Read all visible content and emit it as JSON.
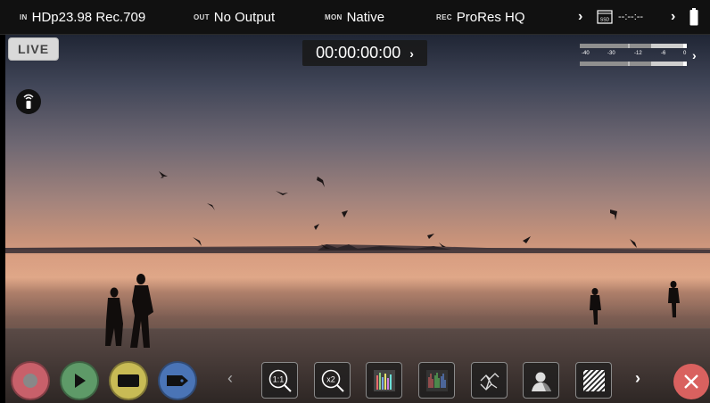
{
  "status_bar": {
    "input": {
      "tag": "IN",
      "value": "HDp23.98 Rec.709"
    },
    "output": {
      "tag": "OUT",
      "value": "No Output"
    },
    "monitor": {
      "tag": "MON",
      "value": "Native"
    },
    "record": {
      "tag": "REC",
      "value": "ProRes HQ"
    },
    "drive_label": "SSD",
    "drive_time": "--:--:--",
    "icons": [
      "chevron-right-icon",
      "ssd-icon",
      "battery-icon"
    ]
  },
  "overlay": {
    "live_label": "LIVE",
    "timecode": "00:00:00:00",
    "meter_scale": [
      "-40",
      "-30",
      "-12",
      "-6",
      "0"
    ],
    "remote_icon": "remote-icon"
  },
  "toolbar": {
    "buttons": [
      {
        "name": "record-button",
        "icon": "record-icon"
      },
      {
        "name": "play-button",
        "icon": "play-icon"
      },
      {
        "name": "display-button",
        "icon": "screen-icon"
      },
      {
        "name": "tag-button",
        "icon": "tag-icon"
      }
    ],
    "tools": [
      {
        "name": "zoom-1to1-tool",
        "label": "1:1"
      },
      {
        "name": "zoom-x2-tool",
        "label": "x2"
      },
      {
        "name": "waveform-tool",
        "label": ""
      },
      {
        "name": "vectorscope-tool",
        "label": ""
      },
      {
        "name": "focus-peaking-tool",
        "label": ""
      },
      {
        "name": "false-color-tool",
        "label": ""
      },
      {
        "name": "zebra-tool",
        "label": ""
      }
    ]
  },
  "colors": {
    "record": "#c8606a",
    "play": "#5e9a68",
    "display": "#c8bb55",
    "tag": "#4a74b6",
    "close": "#d9615f"
  }
}
